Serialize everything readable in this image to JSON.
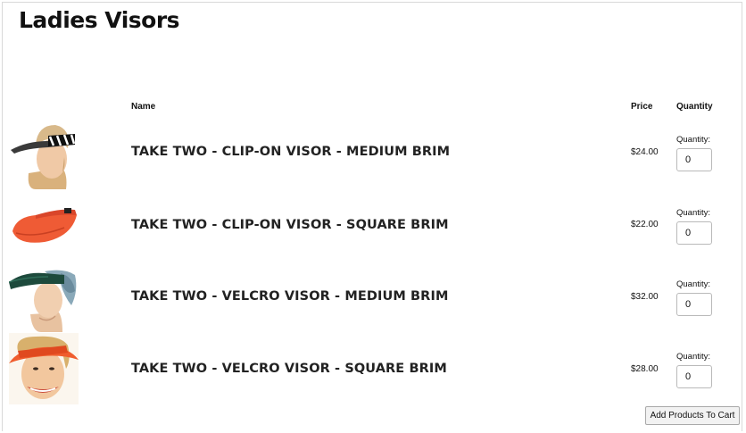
{
  "page": {
    "title": "Ladies Visors"
  },
  "table": {
    "headers": {
      "name": "Name",
      "price": "Price",
      "quantity": "Quantity"
    },
    "rows": [
      {
        "name": "TAKE TWO - CLIP-ON VISOR - MEDIUM BRIM",
        "price": "$24.00",
        "qty_label": "Quantity:",
        "qty_value": "0",
        "image": "visor-striped-medium-brim-photo"
      },
      {
        "name": "TAKE TWO - CLIP-ON VISOR - SQUARE BRIM",
        "price": "$22.00",
        "qty_label": "Quantity:",
        "qty_value": "0",
        "image": "visor-orange-square-brim-photo"
      },
      {
        "name": "TAKE TWO - VELCRO VISOR - MEDIUM BRIM",
        "price": "$32.00",
        "qty_label": "Quantity:",
        "qty_value": "0",
        "image": "visor-green-velcro-medium-photo"
      },
      {
        "name": "TAKE TWO - VELCRO VISOR - SQUARE BRIM",
        "price": "$28.00",
        "qty_label": "Quantity:",
        "qty_value": "0",
        "image": "visor-orange-velcro-square-photo"
      }
    ]
  },
  "actions": {
    "add_to_cart_label": "Add Products To Cart"
  }
}
